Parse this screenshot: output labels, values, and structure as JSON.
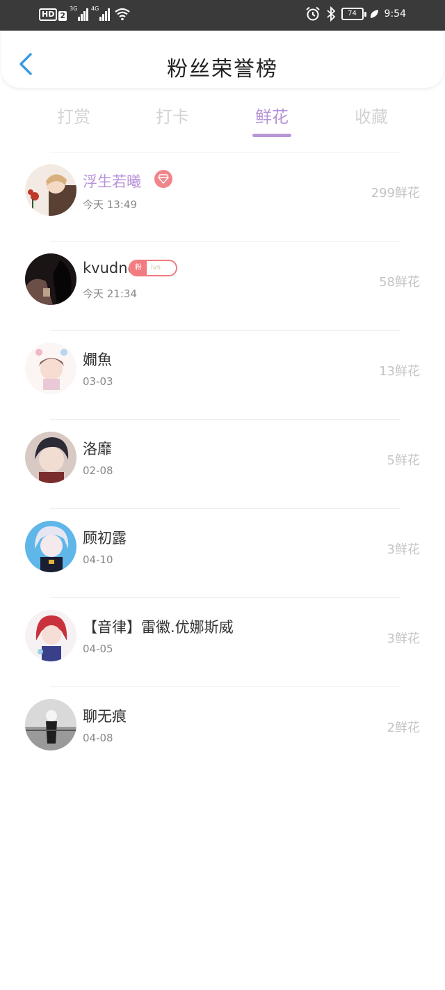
{
  "status": {
    "hd": "HD",
    "sim": "2",
    "net1": "3G",
    "net2": "4G",
    "battery": "74",
    "time": "9:54"
  },
  "header": {
    "title": "粉丝荣誉榜"
  },
  "tabs": [
    {
      "label": "打赏"
    },
    {
      "label": "打卡"
    },
    {
      "label": "鲜花"
    },
    {
      "label": "收藏"
    }
  ],
  "active_tab": "鲜花",
  "colors": {
    "accent": "#b796d6",
    "vip_name": "#b892d8",
    "badge_red": "#f17b7f",
    "status_bar": "#3a3a3a",
    "back_arrow": "#3a9be0"
  },
  "fans": [
    {
      "name": "浮生若曦",
      "time": "今天 13:49",
      "flowers": "299鲜花",
      "badge": "diamond"
    },
    {
      "name": "kvudnd",
      "time": "今天 21:34",
      "flowers": "58鲜花",
      "badge": "fan",
      "badge_left": "粉",
      "badge_right": "lvs"
    },
    {
      "name": "嫺魚",
      "time": "03-03",
      "flowers": "13鲜花"
    },
    {
      "name": "洛靡",
      "time": "02-08",
      "flowers": "5鲜花"
    },
    {
      "name": "顾初露",
      "time": "04-10",
      "flowers": "3鲜花"
    },
    {
      "name": "【音律】雷徽.优娜斯威",
      "time": "04-05",
      "flowers": "3鲜花"
    },
    {
      "name": "聊无痕",
      "time": "04-08",
      "flowers": "2鲜花"
    }
  ]
}
